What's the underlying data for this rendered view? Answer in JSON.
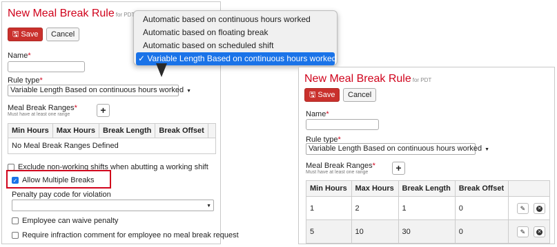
{
  "left": {
    "title": "New Meal Break Rule",
    "title_suffix": "for PDT",
    "save_label": "Save",
    "cancel_label": "Cancel",
    "name_label": "Name",
    "rule_type_label": "Rule type",
    "rule_type_value": "Variable Length Based on continuous hours worked",
    "ranges_label": "Meal Break Ranges",
    "ranges_sub": "Must have at least one range",
    "columns": [
      "Min Hours",
      "Max Hours",
      "Break Length",
      "Break Offset"
    ],
    "empty_text": "No Meal Break Ranges Defined",
    "exclude_label": "Exclude non-working shifts when abutting a working shift",
    "allow_multiple_label": "Allow Multiple Breaks",
    "penalty_label": "Penalty pay code for violation",
    "waive_label": "Employee can waive penalty",
    "infraction_label": "Require infraction comment for employee no meal break request"
  },
  "dropdown": {
    "options": [
      "Automatic based on continuous hours worked",
      "Automatic based on floating break",
      "Automatic based on scheduled shift",
      "Variable Length Based on continuous hours worked"
    ],
    "selected_mark": "✓"
  },
  "right": {
    "title": "New Meal Break Rule",
    "title_suffix": "for PDT",
    "save_label": "Save",
    "cancel_label": "Cancel",
    "name_label": "Name",
    "rule_type_label": "Rule type",
    "rule_type_value": "Variable Length Based on continuous hours worked",
    "ranges_label": "Meal Break Ranges",
    "ranges_sub": "Must have at least one range",
    "columns": [
      "Min Hours",
      "Max Hours",
      "Break Length",
      "Break Offset"
    ],
    "rows": [
      [
        "1",
        "2",
        "1",
        "0"
      ],
      [
        "5",
        "10",
        "30",
        "0"
      ]
    ]
  },
  "colors": {
    "accent_red": "#d0021b",
    "select_blue": "#1a73e8"
  }
}
